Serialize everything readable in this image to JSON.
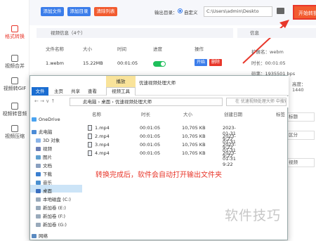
{
  "nav": {
    "items": [
      {
        "label": "格式转换",
        "active": true
      },
      {
        "label": "视频合并",
        "active": false
      },
      {
        "label": "视频转GIF",
        "active": false
      },
      {
        "label": "视频转音频",
        "active": false
      },
      {
        "label": "视频压缩",
        "active": false
      }
    ]
  },
  "toolbar": {
    "add_file": "添加文件",
    "add_dir": "添加目录",
    "clear_list": "清除列表",
    "output_dir_label": "输出目录：",
    "radio_label": "自定义",
    "path_value": "C:\\Users\\admin\\Deskto",
    "start_label": "开始转换"
  },
  "list": {
    "header": "视频信息（4个）",
    "columns": [
      "文件名称",
      "大小",
      "时间",
      "进度",
      "操作"
    ],
    "rows": [
      {
        "name": "1.webm",
        "size": "15.22MB",
        "time": "00:01:05"
      }
    ],
    "play_label": "开始",
    "delete_label": "删除"
  },
  "info": {
    "header": "信息",
    "lines": [
      "扩展名：webm",
      "时长：00:01:05",
      "码率：1935501 bps",
      "高度：1440"
    ]
  },
  "stubs": {
    "label": "标题",
    "quality": "区分",
    "video": "视频"
  },
  "explorer": {
    "manage_label": "播放",
    "title": "优速视频处理大师",
    "tabs": [
      "文件",
      "主页",
      "共享",
      "查看"
    ],
    "video_tools_label": "视频工具",
    "address": [
      "此电脑",
      "桌面",
      "优速视频处理大师"
    ],
    "search_placeholder": "在 优速视频处理大师 中搜索",
    "tree": [
      {
        "label": "OneDrive"
      },
      {
        "label": "此电脑"
      },
      {
        "label": "3D 对象"
      },
      {
        "label": "视频"
      },
      {
        "label": "图片"
      },
      {
        "label": "文档"
      },
      {
        "label": "下载"
      },
      {
        "label": "音乐"
      },
      {
        "label": "桌面"
      },
      {
        "label": "本地磁盘 (C:)"
      },
      {
        "label": "新加卷 (E:)"
      },
      {
        "label": "新加卷 (F:)"
      },
      {
        "label": "新加卷 (G:)"
      },
      {
        "label": "网络"
      }
    ],
    "columns": [
      "名称",
      "时长",
      "大小",
      "创建日期"
    ],
    "sort_label": "标签",
    "files": [
      {
        "name": "1.mp4",
        "duration": "00:01:05",
        "size": "10,705 KB",
        "date": "2023-01-31 9:22"
      },
      {
        "name": "2.mp4",
        "duration": "00:01:05",
        "size": "10,705 KB",
        "date": "2023-01-31 9:22"
      },
      {
        "name": "3.mp4",
        "duration": "00:01:05",
        "size": "10,705 KB",
        "date": "2023-01-31 9:22"
      },
      {
        "name": "4.mp4",
        "duration": "00:01:05",
        "size": "10,705 KB",
        "date": "2023-01-31 9:22"
      }
    ]
  },
  "note": "转换完成后，软件会自动打开输出文件夹",
  "watermark": "软件技巧",
  "colors": {
    "accent": "#3b7dea",
    "highlight": "#e8372b",
    "start": "#f25b2f",
    "toggle": "#1fbf5b"
  }
}
